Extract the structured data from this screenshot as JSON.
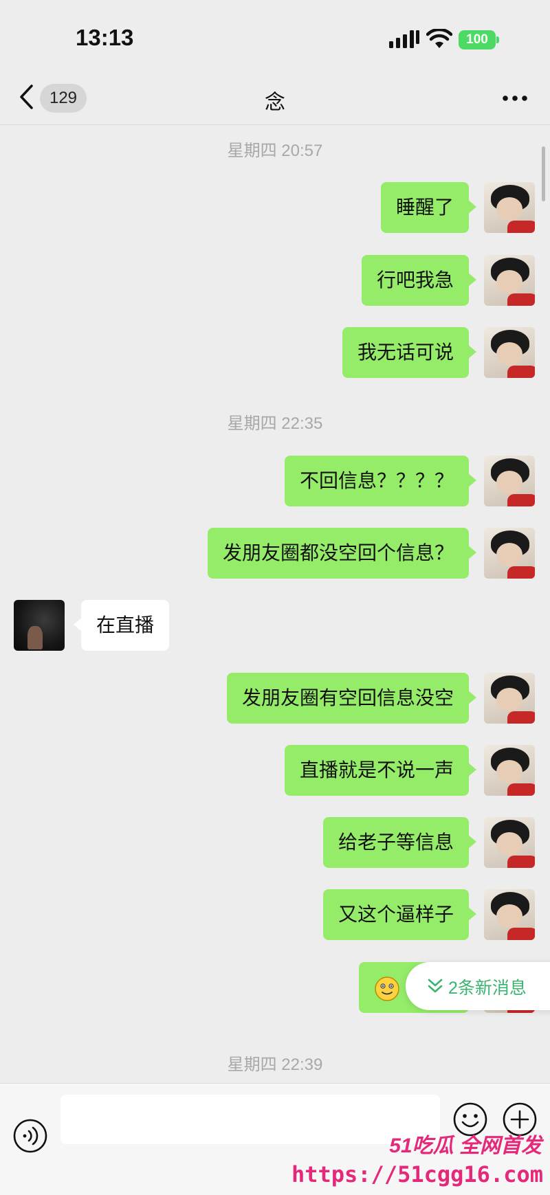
{
  "status_bar": {
    "time": "13:13",
    "battery": "100"
  },
  "nav": {
    "unread_count": "129",
    "title": "念"
  },
  "messages": [
    {
      "type": "timestamp",
      "text": "星期四 20:57"
    },
    {
      "type": "me",
      "text": "睡醒了"
    },
    {
      "type": "me",
      "text": "行吧我急"
    },
    {
      "type": "me",
      "text": "我无话可说"
    },
    {
      "type": "timestamp",
      "text": "星期四 22:35"
    },
    {
      "type": "me",
      "text": "不回信息？？？？"
    },
    {
      "type": "me",
      "text": "发朋友圈都没空回个信息？"
    },
    {
      "type": "other",
      "text": "在直播"
    },
    {
      "type": "me",
      "text": "发朋友圈有空回信息没空"
    },
    {
      "type": "me",
      "text": "直播就是不说一声"
    },
    {
      "type": "me",
      "text": "给老子等信息"
    },
    {
      "type": "me",
      "text": "又这个逼样子"
    },
    {
      "type": "me",
      "text": "",
      "icon": "smiley-emoji-icon"
    },
    {
      "type": "timestamp",
      "text": "星期四 22:39"
    }
  ],
  "new_messages_pill": {
    "label": "2条新消息"
  },
  "input": {
    "placeholder": ""
  },
  "watermark": {
    "line1": "51吃瓜 全网首发",
    "line2": "https://51cgg16.com"
  },
  "colors": {
    "my_bubble": "#95ec69",
    "other_bubble": "#ffffff",
    "background": "#ededed",
    "pill_text": "#3cb371",
    "watermark": "#e4287a"
  }
}
